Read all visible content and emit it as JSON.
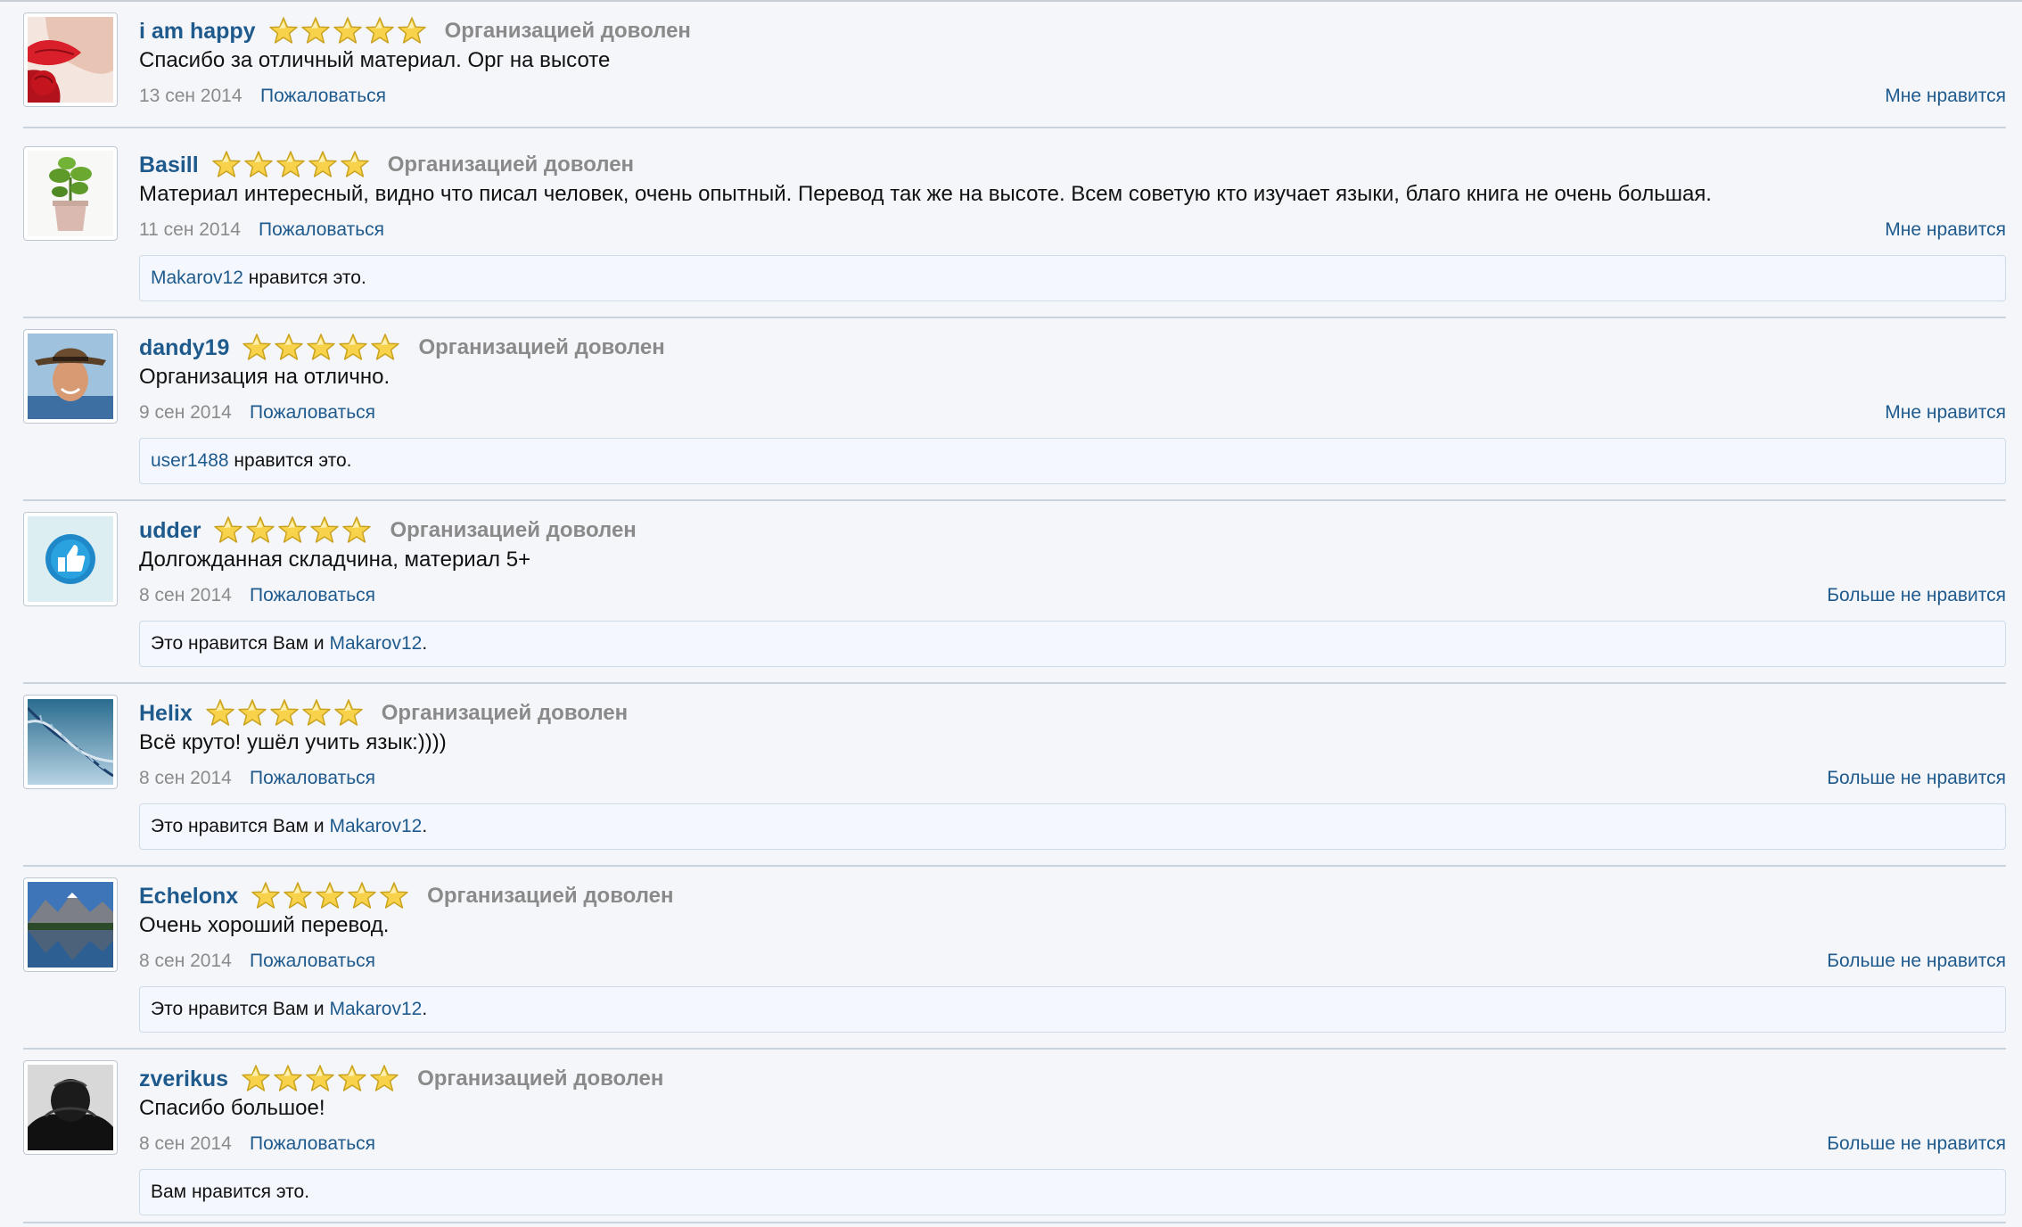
{
  "reviews": [
    {
      "username": "i am happy",
      "rating": 5,
      "rating_text": "Организацией доволен",
      "message": "Спасибо за отличный материал. Орг на высоте",
      "date": "13 сен 2014",
      "report_label": "Пожаловаться",
      "like_label": "Мне нравится",
      "avatar_icon": "lips-rose-avatar",
      "likes": null
    },
    {
      "username": "Basill",
      "rating": 5,
      "rating_text": "Организацией доволен",
      "message": "Материал интересный, видно что писал человек, очень опытный. Перевод так же на высоте. Всем советую кто изучает языки, благо книга не очень большая.",
      "date": "11 сен 2014",
      "report_label": "Пожаловаться",
      "like_label": "Мне нравится",
      "avatar_icon": "potted-plant-avatar",
      "likes": {
        "prefix": "",
        "user": "Makarov12",
        "suffix": " нравится это."
      }
    },
    {
      "username": "dandy19",
      "rating": 5,
      "rating_text": "Организацией доволен",
      "message": "Организация на отлично.",
      "date": "9 сен 2014",
      "report_label": "Пожаловаться",
      "like_label": "Мне нравится",
      "avatar_icon": "man-in-hat-avatar",
      "likes": {
        "prefix": "",
        "user": "user1488",
        "suffix": " нравится это."
      }
    },
    {
      "username": "udder",
      "rating": 5,
      "rating_text": "Организацией доволен",
      "message": "Долгожданная складчина, материал 5+",
      "date": "8 сен 2014",
      "report_label": "Пожаловаться",
      "like_label": "Больше не нравится",
      "avatar_icon": "thumbs-up-badge-avatar",
      "likes": {
        "prefix": "Это нравится Вам и ",
        "user": "Makarov12",
        "suffix": "."
      }
    },
    {
      "username": "Helix",
      "rating": 5,
      "rating_text": "Организацией доволен",
      "message": "Всё круто! ушёл учить язык:))))",
      "date": "8 сен 2014",
      "report_label": "Пожаловаться",
      "like_label": "Больше не нравится",
      "avatar_icon": "dna-helix-avatar",
      "likes": {
        "prefix": "Это нравится Вам и ",
        "user": "Makarov12",
        "suffix": "."
      }
    },
    {
      "username": "Echelonx",
      "rating": 5,
      "rating_text": "Организацией доволен",
      "message": "Очень хороший перевод.",
      "date": "8 сен 2014",
      "report_label": "Пожаловаться",
      "like_label": "Больше не нравится",
      "avatar_icon": "mountain-lake-avatar",
      "likes": {
        "prefix": "Это нравится Вам и ",
        "user": "Makarov12",
        "suffix": "."
      }
    },
    {
      "username": "zverikus",
      "rating": 5,
      "rating_text": "Организацией доволен",
      "message": "Спасибо большое!",
      "date": "8 сен 2014",
      "report_label": "Пожаловаться",
      "like_label": "Больше не нравится",
      "avatar_icon": "person-head-down-avatar",
      "likes": {
        "prefix": "Вам нравится это.",
        "user": "",
        "suffix": ""
      }
    }
  ],
  "colors": {
    "link": "#1f5a8d",
    "muted": "#8b8b8b",
    "star_fill": "#f7d24a",
    "star_stroke": "#c9a21f",
    "like_box_bg": "#f4f8fe"
  }
}
